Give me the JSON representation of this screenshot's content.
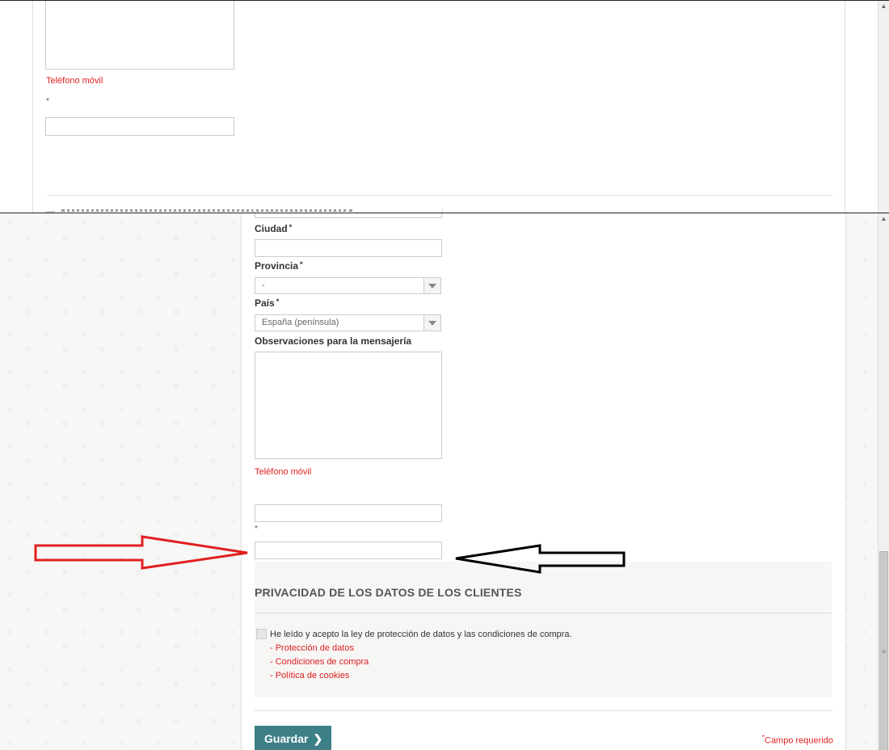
{
  "top_view": {
    "mobile_label": "Teléfono móvil",
    "asterisk": "*"
  },
  "form": {
    "city_label": "Ciudad",
    "province_label": "Provincia",
    "province_value": "-",
    "country_label": "País",
    "country_value": "España (península)",
    "notes_label": "Observaciones para la mensajería",
    "mobile_label": "Teléfono móvil",
    "required_mark": "*",
    "asterisk": "*"
  },
  "privacy": {
    "title": "PRIVACIDAD DE LOS DATOS DE LOS CLIENTES",
    "accept_text": "He leído y acepto la ley de protección de datos y las condiciones de compra.",
    "links": [
      "- Protección de datos",
      "- Condiciones de compra",
      "- Política de cookies"
    ]
  },
  "actions": {
    "save_label": "Guardar",
    "required_note_mark": "*",
    "required_note": "Campo requerido"
  },
  "colors": {
    "accent": "#3d7f86",
    "required_red": "#e02020",
    "red_arrow": "#e02020",
    "black_arrow": "#000000"
  },
  "icons": [
    "chevron-right-icon",
    "dropdown-arrow-icon",
    "red-arrow-annotation",
    "black-arrow-annotation"
  ]
}
